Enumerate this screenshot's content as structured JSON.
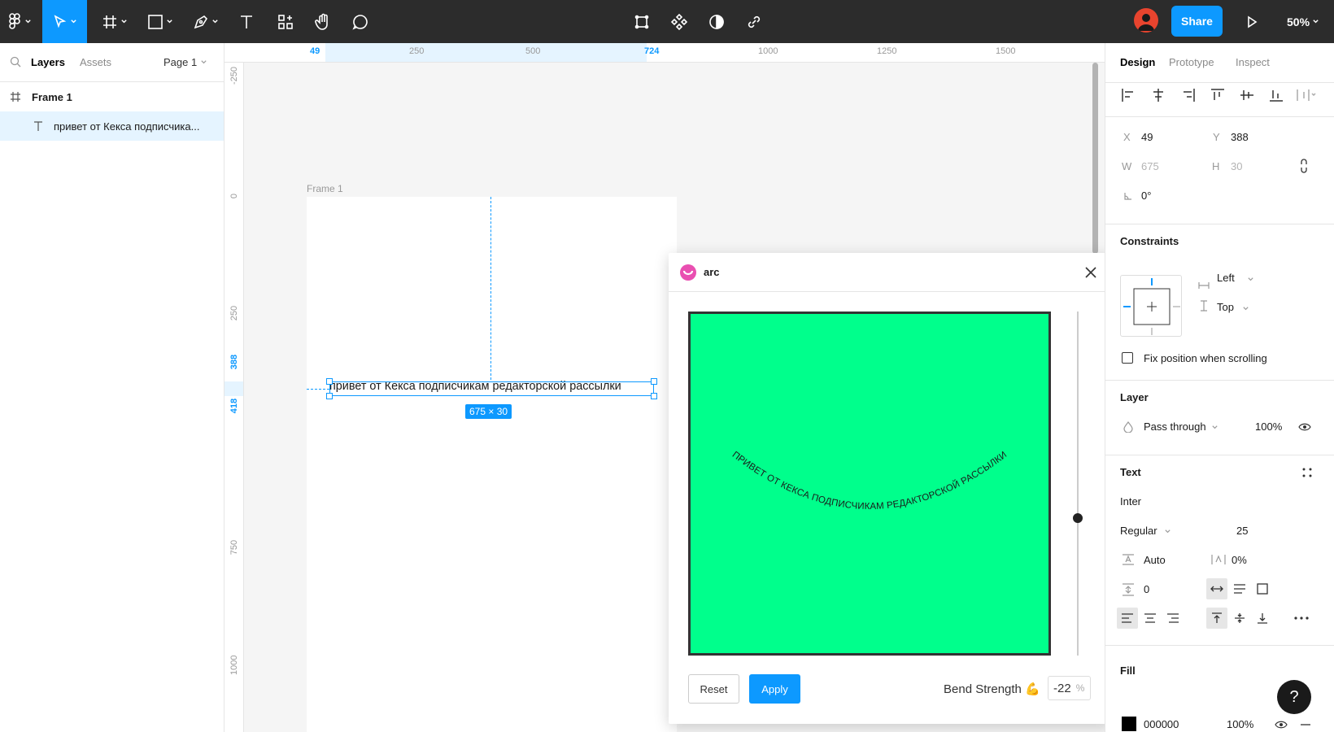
{
  "toolbar": {
    "share_label": "Share",
    "zoom_label": "50%",
    "tools": [
      "main-menu",
      "move",
      "frame",
      "shape",
      "pen",
      "text",
      "resources",
      "hand",
      "comment"
    ],
    "center_tools": [
      "crop",
      "components",
      "mask",
      "link"
    ]
  },
  "left_panel": {
    "tabs": {
      "layers": "Layers",
      "assets": "Assets"
    },
    "page_selector": "Page 1",
    "layers": [
      {
        "name": "Frame 1",
        "icon": "frame-icon"
      },
      {
        "name": "привет от Кекса подписчика...",
        "icon": "text-icon"
      }
    ]
  },
  "rulers": {
    "top": [
      "49",
      "250",
      "500",
      "724",
      "1000",
      "1250",
      "1500"
    ],
    "left": [
      "-250",
      "0",
      "250",
      "388",
      "418",
      "750",
      "1000"
    ]
  },
  "canvas": {
    "frame_label": "Frame 1",
    "text_content": "привет от Кекса подписчикам редакторской рассылки",
    "dimension_badge": "675 × 30"
  },
  "plugin": {
    "title": "arc",
    "preview_text": "ПРИВЕТ ОТ КЕКСА ПОДПИСЧИКАМ РЕДАКТОРСКОЙ РАССЫЛКИ",
    "reset_label": "Reset",
    "apply_label": "Apply",
    "bend_label": "Bend Strength 💪",
    "bend_value": "-22",
    "bend_unit": "%",
    "preview_color": "#00ff8c"
  },
  "right_panel": {
    "tabs": {
      "design": "Design",
      "prototype": "Prototype",
      "inspect": "Inspect"
    },
    "position": {
      "x_label": "X",
      "x": "49",
      "y_label": "Y",
      "y": "388",
      "w_label": "W",
      "w": "675",
      "h_label": "H",
      "h": "30",
      "rotation": "0°"
    },
    "constraints": {
      "title": "Constraints",
      "horizontal": "Left",
      "vertical": "Top",
      "fix_position": "Fix position when scrolling"
    },
    "layer": {
      "title": "Layer",
      "blend": "Pass through",
      "opacity": "100%"
    },
    "text": {
      "title": "Text",
      "font": "Inter",
      "weight": "Regular",
      "size": "25",
      "line_height": "Auto",
      "letter_spacing": "0%",
      "paragraph_spacing": "0"
    },
    "fill": {
      "title": "Fill",
      "hex": "000000",
      "opacity": "100%"
    }
  },
  "help_label": "?"
}
